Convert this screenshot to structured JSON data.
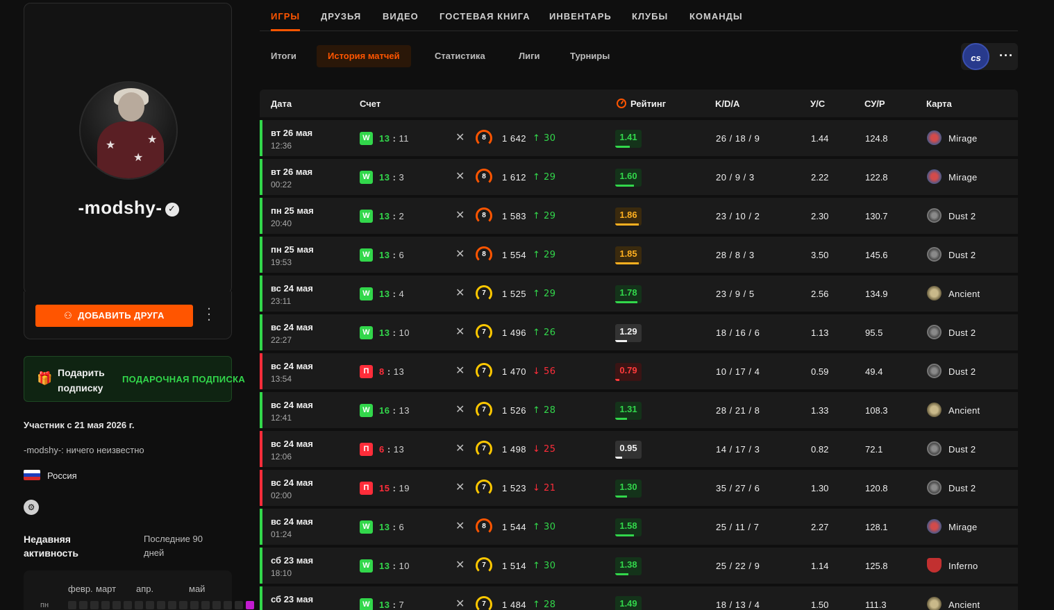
{
  "profile": {
    "nickname": "-modshy-",
    "add_friend_label": "ДОБАВИТЬ ДРУГА",
    "gift_title": "Подарить подписку",
    "gift_cta": "ПОДАРОЧНАЯ ПОДПИСКА",
    "member_since": "Участник с 21 мая 2026 г.",
    "bio": "-modshy-: ничего неизвестно",
    "country": "Россия",
    "activity_title": "Недавняя активность",
    "activity_range": "Последние 90 дней",
    "activity_months": [
      "февр.",
      "март",
      "апр.",
      "май"
    ],
    "activity_day_label": "пн"
  },
  "colors": {
    "accent": "#ff5500",
    "win": "#32d74b",
    "loss": "#ff2d3a",
    "level8": "#ff5500",
    "level7": "#ffc800"
  },
  "main_tabs": [
    "ИГРЫ",
    "ДРУЗЬЯ",
    "ВИДЕО",
    "ГОСТЕВАЯ КНИГА",
    "ИНВЕНТАРЬ",
    "КЛУБЫ",
    "КОМАНДЫ"
  ],
  "sub_tabs": [
    "Итоги",
    "История матчей",
    "Статистика",
    "Лиги",
    "Турниры"
  ],
  "game_badge": "cs",
  "table": {
    "headers": {
      "date": "Дата",
      "score": "Счет",
      "rating": "Рейтинг",
      "kda": "K/D/A",
      "kr": "У/С",
      "adr": "СУ/Р",
      "map": "Карта"
    },
    "rows": [
      {
        "date": "вт 26 мая",
        "time": "12:36",
        "result": "W",
        "own": "13",
        "opp": "11",
        "level": "8",
        "elo": "1 642",
        "change": "↑ 30",
        "rating": "1.41",
        "rating_level": 0.55,
        "kda": "26 / 18 / 9",
        "kr": "1.44",
        "adr": "124.8",
        "map": "Mirage"
      },
      {
        "date": "вт 26 мая",
        "time": "00:22",
        "result": "W",
        "own": "13",
        "opp": "3",
        "level": "8",
        "elo": "1 612",
        "change": "↑ 29",
        "rating": "1.60",
        "rating_level": 0.7,
        "kda": "20 / 9 / 3",
        "kr": "2.22",
        "adr": "122.8",
        "map": "Mirage"
      },
      {
        "date": "пн 25 мая",
        "time": "20:40",
        "result": "W",
        "own": "13",
        "opp": "2",
        "level": "8",
        "elo": "1 583",
        "change": "↑ 29",
        "rating": "1.86",
        "rating_level": 0.9,
        "kda": "23 / 10 / 2",
        "kr": "2.30",
        "adr": "130.7",
        "map": "Dust 2"
      },
      {
        "date": "пн 25 мая",
        "time": "19:53",
        "result": "W",
        "own": "13",
        "opp": "6",
        "level": "8",
        "elo": "1 554",
        "change": "↑ 29",
        "rating": "1.85",
        "rating_level": 0.9,
        "kda": "28 / 8 / 3",
        "kr": "3.50",
        "adr": "145.6",
        "map": "Dust 2"
      },
      {
        "date": "вс 24 мая",
        "time": "23:11",
        "result": "W",
        "own": "13",
        "opp": "4",
        "level": "7",
        "elo": "1 525",
        "change": "↑ 29",
        "rating": "1.78",
        "rating_level": 0.85,
        "kda": "23 / 9 / 5",
        "kr": "2.56",
        "adr": "134.9",
        "map": "Ancient"
      },
      {
        "date": "вс 24 мая",
        "time": "22:27",
        "result": "W",
        "own": "13",
        "opp": "10",
        "level": "7",
        "elo": "1 496",
        "change": "↑ 26",
        "rating": "1.29",
        "rating_level": 0.45,
        "kda": "18 / 16 / 6",
        "kr": "1.13",
        "adr": "95.5",
        "map": "Dust 2"
      },
      {
        "date": "вс 24 мая",
        "time": "13:54",
        "result": "П",
        "own": "8",
        "opp": "13",
        "level": "7",
        "elo": "1 470",
        "change": "↓ 56",
        "rating": "0.79",
        "rating_level": 0.15,
        "kda": "10 / 17 / 4",
        "kr": "0.59",
        "adr": "49.4",
        "map": "Dust 2"
      },
      {
        "date": "вс 24 мая",
        "time": "12:41",
        "result": "W",
        "own": "16",
        "opp": "13",
        "level": "7",
        "elo": "1 526",
        "change": "↑ 28",
        "rating": "1.31",
        "rating_level": 0.45,
        "kda": "28 / 21 / 8",
        "kr": "1.33",
        "adr": "108.3",
        "map": "Ancient"
      },
      {
        "date": "вс 24 мая",
        "time": "12:06",
        "result": "П",
        "own": "6",
        "opp": "13",
        "level": "7",
        "elo": "1 498",
        "change": "↓ 25",
        "rating": "0.95",
        "rating_level": 0.25,
        "kda": "14 / 17 / 3",
        "kr": "0.82",
        "adr": "72.1",
        "map": "Dust 2"
      },
      {
        "date": "вс 24 мая",
        "time": "02:00",
        "result": "П",
        "own": "15",
        "opp": "19",
        "level": "7",
        "elo": "1 523",
        "change": "↓ 21",
        "rating": "1.30",
        "rating_level": 0.45,
        "kda": "35 / 27 / 6",
        "kr": "1.30",
        "adr": "120.8",
        "map": "Dust 2"
      },
      {
        "date": "вс 24 мая",
        "time": "01:24",
        "result": "W",
        "own": "13",
        "opp": "6",
        "level": "8",
        "elo": "1 544",
        "change": "↑ 30",
        "rating": "1.58",
        "rating_level": 0.7,
        "kda": "25 / 11 / 7",
        "kr": "2.27",
        "adr": "128.1",
        "map": "Mirage"
      },
      {
        "date": "сб 23 мая",
        "time": "18:10",
        "result": "W",
        "own": "13",
        "opp": "10",
        "level": "7",
        "elo": "1 514",
        "change": "↑ 30",
        "rating": "1.38",
        "rating_level": 0.5,
        "kda": "25 / 22 / 9",
        "kr": "1.14",
        "adr": "125.8",
        "map": "Inferno"
      },
      {
        "date": "сб 23 мая",
        "time": "",
        "result": "W",
        "own": "13",
        "opp": "7",
        "level": "7",
        "elo": "1 484",
        "change": "↑ 28",
        "rating": "1.49",
        "rating_level": 0.6,
        "kda": "18 / 13 / 4",
        "kr": "1.50",
        "adr": "111.3",
        "map": "Ancient"
      }
    ]
  }
}
